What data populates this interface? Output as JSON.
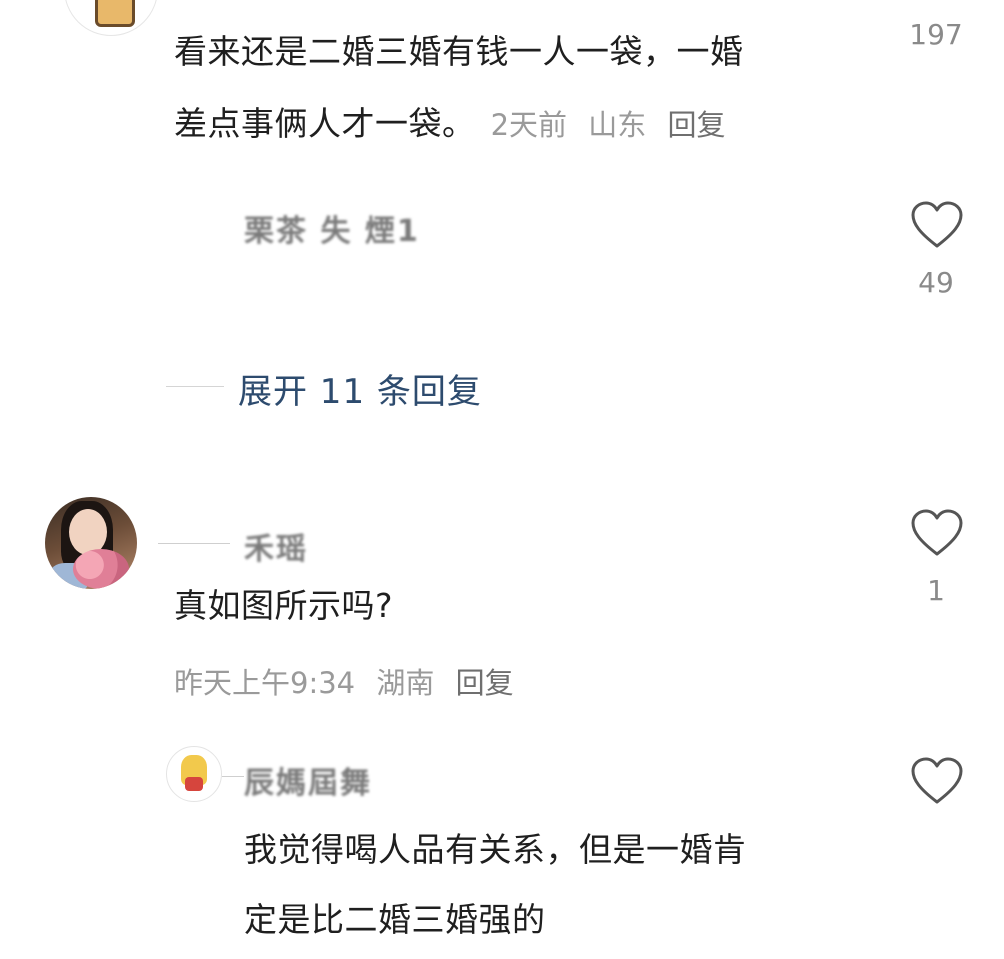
{
  "comments": [
    {
      "text_line1": "看来还是二婚三婚有钱一人一袋，一婚",
      "text_line2": "差点事俩人才一袋。",
      "time": "2天前",
      "location": "山东",
      "reply_label": "回复",
      "likes": "197",
      "heart_icon": "heart-outline-icon"
    },
    {
      "author": "栗茶 失 煙1",
      "likes": "49",
      "heart_icon": "heart-outline-icon",
      "expand_label": "展开 11 条回复"
    },
    {
      "author": "禾瑶",
      "text": "真如图所示吗?",
      "time": "昨天上午9:34",
      "location": "湖南",
      "reply_label": "回复",
      "likes": "1",
      "heart_icon": "heart-outline-icon"
    },
    {
      "author": "辰媽屆舞",
      "text_line1": "我觉得喝人品有关系，但是一婚肯",
      "text_line2": "定是比二婚三婚强的",
      "heart_icon": "heart-outline-icon"
    }
  ],
  "colors": {
    "text": "#1f1f1f",
    "meta": "#9a9a9a",
    "expand_link": "#2d4b6e",
    "heart_stroke": "#555555"
  }
}
